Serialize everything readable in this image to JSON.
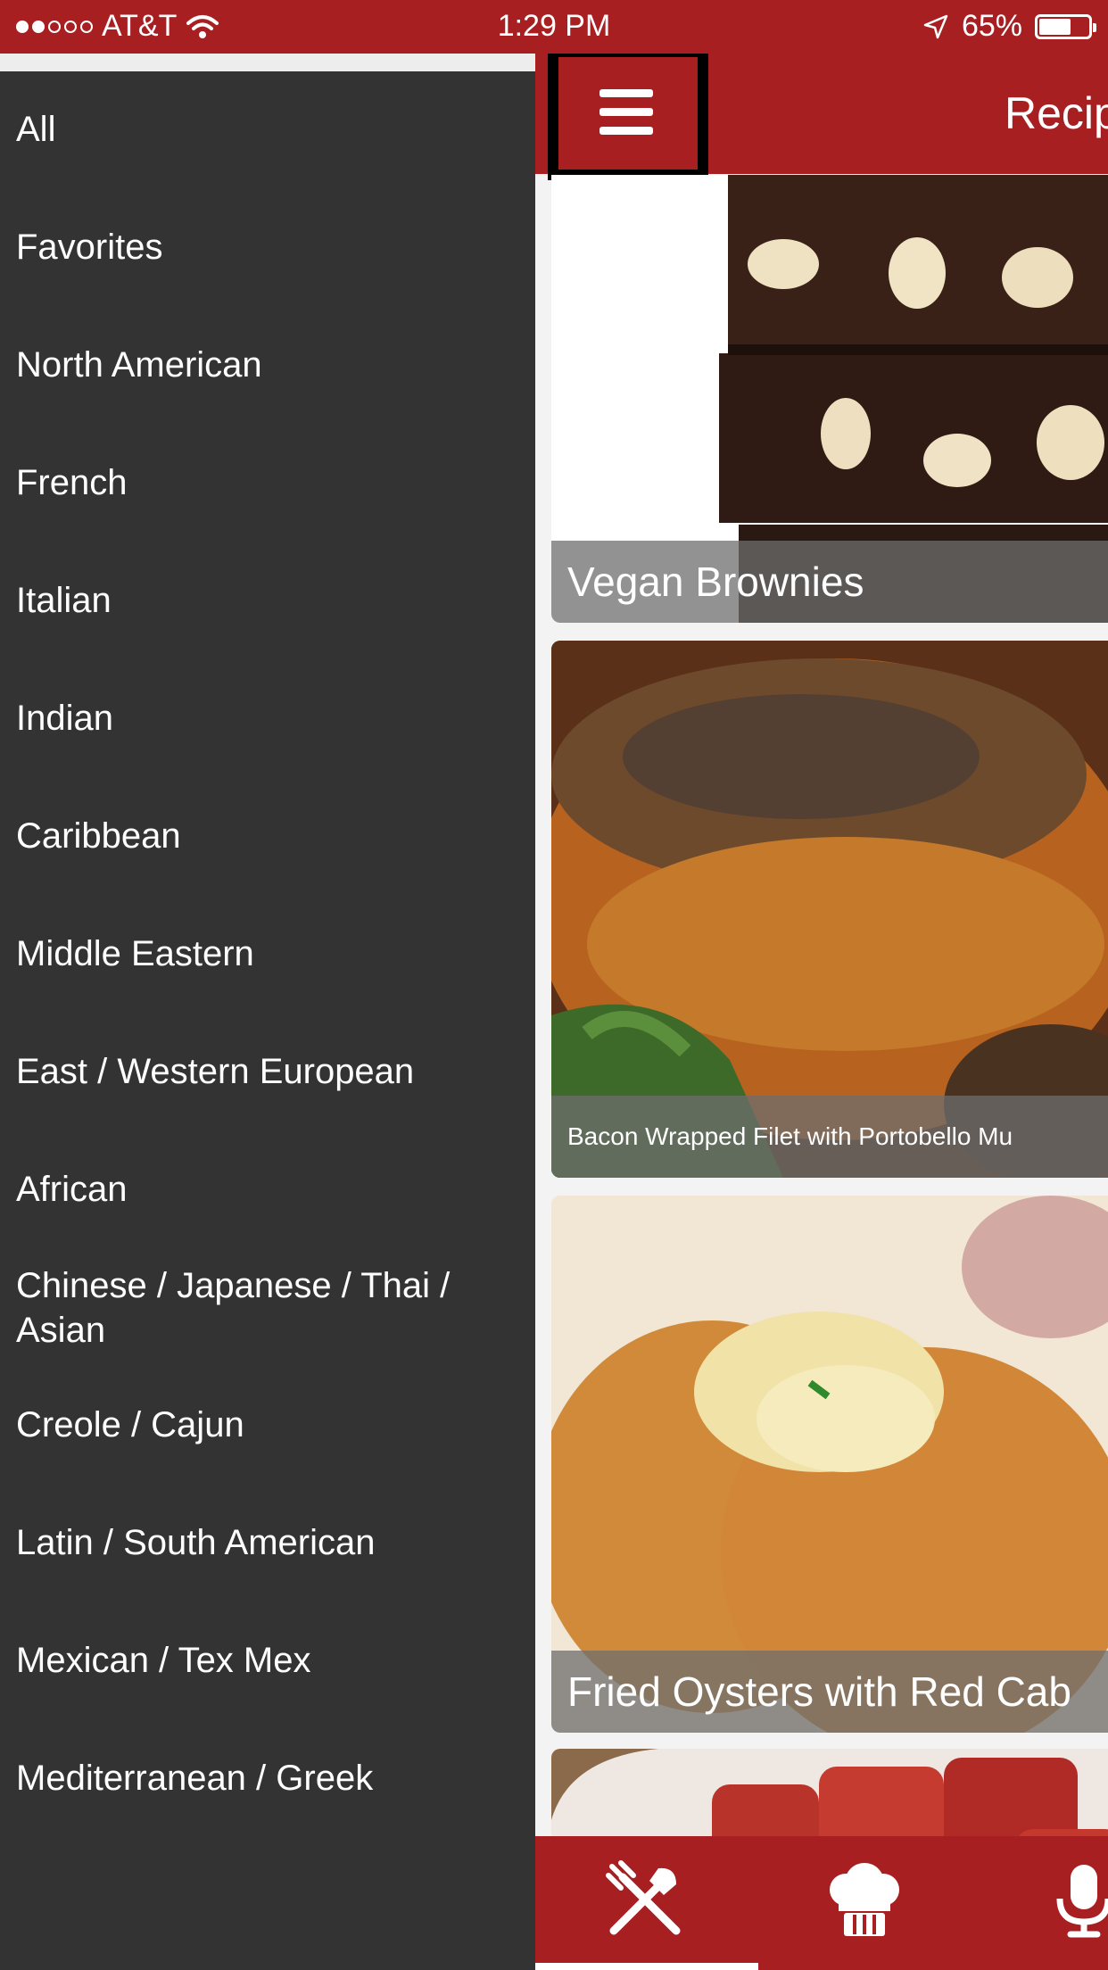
{
  "status_bar": {
    "carrier": "AT&T",
    "time": "1:29 PM",
    "battery": "65%",
    "battery_level": 0.65,
    "signal_bars_filled": 2,
    "signal_bars_total": 5
  },
  "side_menu": {
    "items": [
      {
        "label": "All"
      },
      {
        "label": "Favorites"
      },
      {
        "label": "North American"
      },
      {
        "label": "French"
      },
      {
        "label": "Italian"
      },
      {
        "label": "Indian"
      },
      {
        "label": "Caribbean"
      },
      {
        "label": "Middle Eastern"
      },
      {
        "label": "East / Western European"
      },
      {
        "label": "African"
      },
      {
        "label": "Chinese / Japanese / Thai / Asian"
      },
      {
        "label": "Creole / Cajun"
      },
      {
        "label": "Latin / South American"
      },
      {
        "label": "Mexican / Tex Mex"
      },
      {
        "label": "Mediterranean / Greek"
      }
    ]
  },
  "header": {
    "title": "Recip"
  },
  "recipes": [
    {
      "title": "Vegan Brownies"
    },
    {
      "title": "Bacon Wrapped Filet with Portobello Mu"
    },
    {
      "title": "Fried Oysters with Red Cab"
    }
  ],
  "tab_bar": {
    "tabs": [
      {
        "icon": "utensils-icon"
      },
      {
        "icon": "chef-hat-icon"
      },
      {
        "icon": "microphone-icon"
      }
    ]
  },
  "colors": {
    "brand_red": "#a81f22",
    "menu_background": "#333333"
  }
}
